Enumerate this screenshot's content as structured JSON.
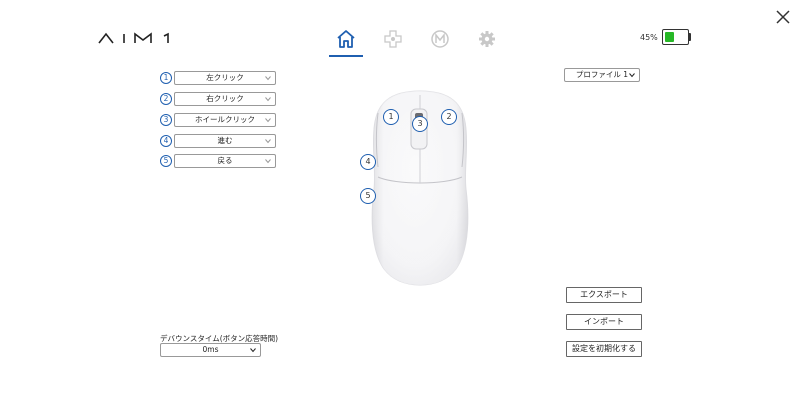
{
  "app": {
    "logo_text": "AIM1"
  },
  "nav": {
    "tabs": [
      {
        "name": "home",
        "icon": "home-icon",
        "active": true
      },
      {
        "name": "dpi",
        "icon": "dpad-icon",
        "active": false
      },
      {
        "name": "macro",
        "icon": "macro-m-icon",
        "active": false
      },
      {
        "name": "settings",
        "icon": "gear-icon",
        "active": false
      }
    ]
  },
  "battery": {
    "percent_text": "45%",
    "level": 0.45,
    "color": "#27b827"
  },
  "profile": {
    "selected": "プロファイル 1"
  },
  "buttons": [
    {
      "number": "1",
      "action": "左クリック"
    },
    {
      "number": "2",
      "action": "右クリック"
    },
    {
      "number": "3",
      "action": "ホイールクリック"
    },
    {
      "number": "4",
      "action": "進む"
    },
    {
      "number": "5",
      "action": "戻る"
    }
  ],
  "mouse_labels": [
    "1",
    "2",
    "3",
    "4",
    "5"
  ],
  "actions": {
    "export": "エクスポート",
    "import": "インポート",
    "reset": "設定を初期化する"
  },
  "debounce": {
    "label": "デバウンスタイム(ボタン応答時間)",
    "value": "0ms"
  },
  "colors": {
    "accent": "#1f5fb0"
  }
}
